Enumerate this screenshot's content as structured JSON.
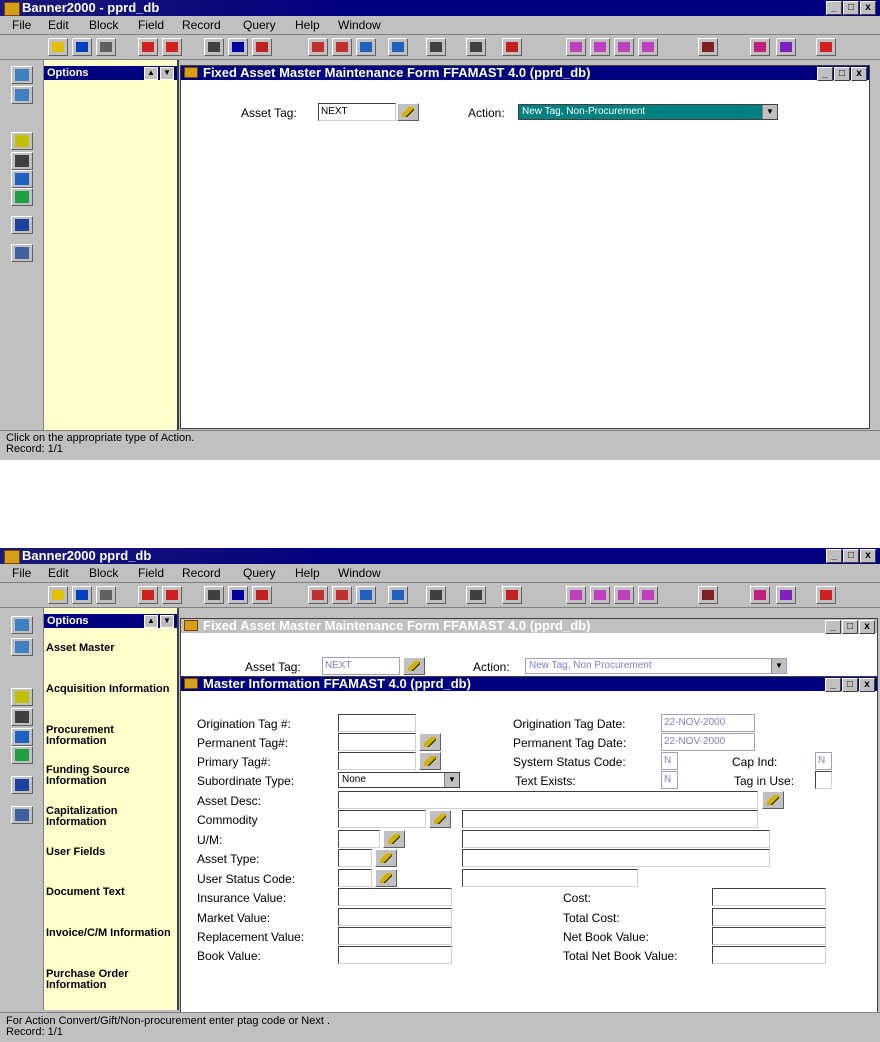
{
  "app_title": "Banner2000 - pprd_db",
  "app_title_2": "Banner2000   pprd_db",
  "menu": [
    "File",
    "Edit",
    "Block",
    "Field",
    "Record",
    "Query",
    "Help",
    "Window"
  ],
  "window_buttons": {
    "minimize": "_",
    "restore": "□",
    "close": "x"
  },
  "options_title": "Options",
  "top": {
    "form_title": "Fixed  Asset Master Maintenance Form  FFAMAST  4.0  (pprd_db)",
    "asset_tag_label": "Asset Tag:",
    "asset_tag_value": "NEXT",
    "action_label": "Action:",
    "action_value": "New Tag, Non-Procurement",
    "status_line1": "Click on the appropriate type of Action.",
    "status_line2": "Record: 1/1"
  },
  "bottom": {
    "form_title": "Fixed  Asset Master Maintenance Form  FFAMAST  4.0  (pprd_db)",
    "asset_tag_label": "Asset Tag:",
    "asset_tag_value": "NEXT",
    "action_label": "Action:",
    "action_value": "New Tag, Non Procurement",
    "sub_title": "Master Information  FFAMAST  4.0  (pprd_db)",
    "options": [
      "Asset Master",
      "Acquisition Information",
      "Procurement Information",
      "Funding Source Information",
      "Capitalization Information",
      "User Fields",
      "Document Text",
      "Invoice/C/M Information",
      "Purchase Order Information"
    ],
    "labels": {
      "origination_tag": "Origination Tag #:",
      "permanent_tag": "Permanent Tag#:",
      "primary_tag": "Primary Tag#:",
      "subordinate_type": "Subordinate Type:",
      "asset_desc": "Asset Desc:",
      "commodity": "Commodity",
      "um": "U/M:",
      "asset_type": "Asset Type:",
      "user_status_code": "User Status Code:",
      "insurance_value": "Insurance Value:",
      "market_value": "Market Value:",
      "replacement_value": "Replacement Value:",
      "book_value": "Book Value:",
      "origination_tag_date": "Origination Tag Date:",
      "permanent_tag_date": "Permanent Tag Date:",
      "system_status_code": "System Status Code:",
      "cap_ind": "Cap Ind:",
      "text_exists": "Text Exists:",
      "tag_in_use": "Tag in Use:",
      "cost": "Cost:",
      "total_cost": "Total Cost:",
      "net_book_value": "Net Book Value:",
      "total_net_book_value": "Total Net Book Value:"
    },
    "values": {
      "subordinate_type": "None",
      "origination_tag_date": "22-NOV-2000",
      "permanent_tag_date": "22-NOV-2000",
      "system_status_code": "N",
      "cap_ind": "N",
      "text_exists": "N"
    },
    "status_line1": "For Action Convert/Gift/Non-procurement enter ptag code or Next .",
    "status_line2": "Record: 1/1"
  }
}
